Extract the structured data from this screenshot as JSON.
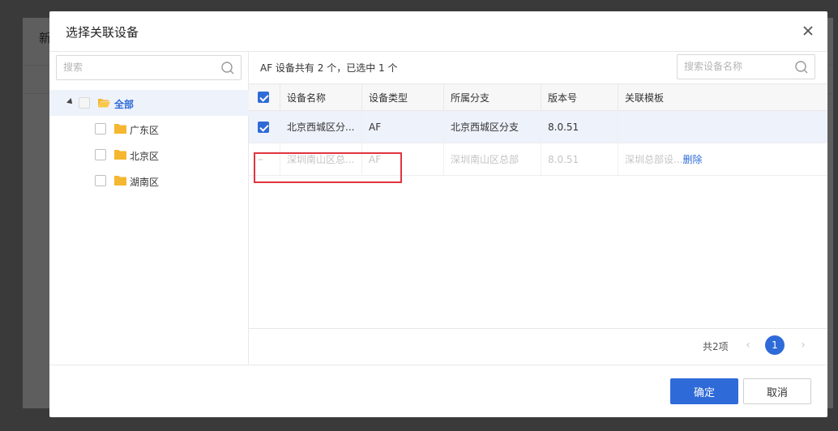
{
  "background": {
    "title_fragment": "新"
  },
  "modal": {
    "title": "选择关联设备"
  },
  "left": {
    "search_placeholder": "搜索",
    "tree": {
      "root_label": "全部",
      "children": [
        {
          "label": "广东区"
        },
        {
          "label": "北京区"
        },
        {
          "label": "湖南区"
        }
      ]
    }
  },
  "right": {
    "info": "AF 设备共有 2 个，已选中 1 个",
    "search_placeholder": "搜索设备名称",
    "columns": [
      "设备名称",
      "设备类型",
      "所属分支",
      "版本号",
      "关联模板"
    ],
    "rows": [
      {
        "selected": true,
        "disabled": false,
        "name": "北京西城区分...",
        "type": "AF",
        "branch": "北京西城区分支",
        "version": "8.0.51",
        "template": "",
        "action": ""
      },
      {
        "selected": false,
        "disabled": true,
        "marker": "–",
        "name": "深圳南山区总...",
        "type": "AF",
        "branch": "深圳南山区总部",
        "version": "8.0.51",
        "template": "深圳总部设...",
        "action": "删除"
      }
    ]
  },
  "pagination": {
    "total": "共2项",
    "current": "1",
    "prev": "‹",
    "next": "›"
  },
  "footer": {
    "ok_label": "确定",
    "cancel_label": "取消"
  },
  "colors": {
    "accent": "#2f6bd8",
    "highlight": "#e0343e",
    "folder": "#f5b731"
  }
}
